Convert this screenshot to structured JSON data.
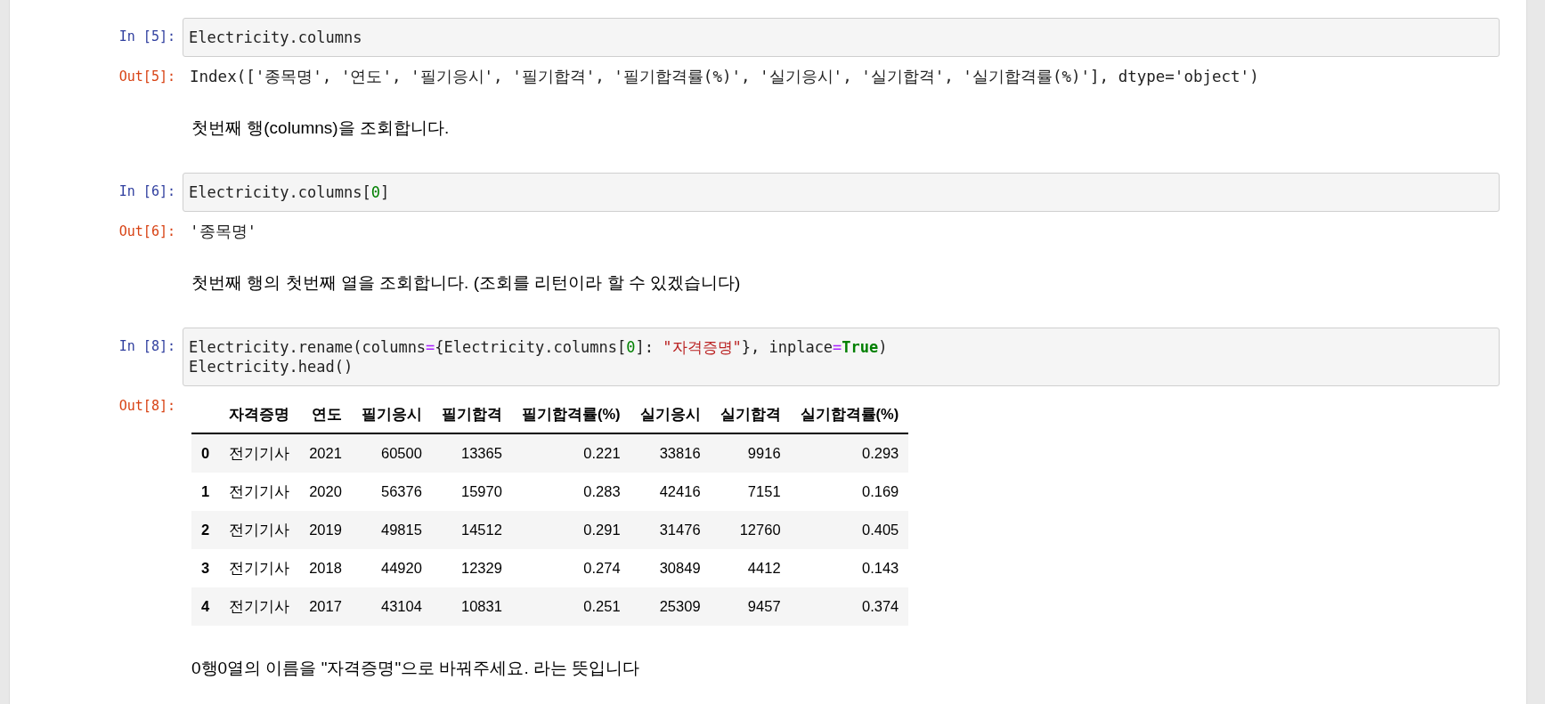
{
  "cells": [
    {
      "kind": "code",
      "prompt": "In [5]:",
      "lines": [
        [
          {
            "kind": "plain",
            "text": "Electricity.columns"
          }
        ]
      ],
      "output": {
        "prompt": "Out[5]:",
        "kind": "text",
        "text": "Index(['종목명', '연도', '필기응시', '필기합격', '필기합격률(%)', '실기응시', '실기합격', '실기합격률(%)'], dtype='object')"
      }
    },
    {
      "kind": "markdown",
      "text": "첫번째 행(columns)을 조회합니다."
    },
    {
      "kind": "code",
      "prompt": "In [6]:",
      "lines": [
        [
          {
            "kind": "plain",
            "text": "Electricity.columns["
          },
          {
            "kind": "number",
            "text": "0"
          },
          {
            "kind": "plain",
            "text": "]"
          }
        ]
      ],
      "output": {
        "prompt": "Out[6]:",
        "kind": "text",
        "text": "'종목명'"
      }
    },
    {
      "kind": "markdown",
      "text": "첫번째 행의 첫번째 열을 조회합니다. (조회를 리턴이라 할 수 있겠습니다)"
    },
    {
      "kind": "code",
      "prompt": "In [8]:",
      "lines": [
        [
          {
            "kind": "plain",
            "text": "Electricity.rename(columns"
          },
          {
            "kind": "operator",
            "text": "="
          },
          {
            "kind": "plain",
            "text": "{Electricity.columns["
          },
          {
            "kind": "number",
            "text": "0"
          },
          {
            "kind": "plain",
            "text": "]: "
          },
          {
            "kind": "string",
            "text": "\"자격증명\""
          },
          {
            "kind": "plain",
            "text": "}, inplace"
          },
          {
            "kind": "operator",
            "text": "="
          },
          {
            "kind": "keyword",
            "text": "True"
          },
          {
            "kind": "plain",
            "text": ")"
          }
        ],
        [
          {
            "kind": "plain",
            "text": "Electricity.head()"
          }
        ]
      ],
      "output": {
        "prompt": "Out[8]:",
        "kind": "table",
        "columns": [
          "",
          "자격증명",
          "연도",
          "필기응시",
          "필기합격",
          "필기합격률(%)",
          "실기응시",
          "실기합격",
          "실기합격률(%)"
        ],
        "rows": [
          [
            "0",
            "전기기사",
            "2021",
            "60500",
            "13365",
            "0.221",
            "33816",
            "9916",
            "0.293"
          ],
          [
            "1",
            "전기기사",
            "2020",
            "56376",
            "15970",
            "0.283",
            "42416",
            "7151",
            "0.169"
          ],
          [
            "2",
            "전기기사",
            "2019",
            "49815",
            "14512",
            "0.291",
            "31476",
            "12760",
            "0.405"
          ],
          [
            "3",
            "전기기사",
            "2018",
            "44920",
            "12329",
            "0.274",
            "30849",
            "4412",
            "0.143"
          ],
          [
            "4",
            "전기기사",
            "2017",
            "43104",
            "10831",
            "0.251",
            "25309",
            "9457",
            "0.374"
          ]
        ]
      }
    },
    {
      "kind": "markdown",
      "text": "0행0열의 이름을 \"자격증명\"으로 바꿔주세요. 라는 뜻입니다"
    }
  ]
}
